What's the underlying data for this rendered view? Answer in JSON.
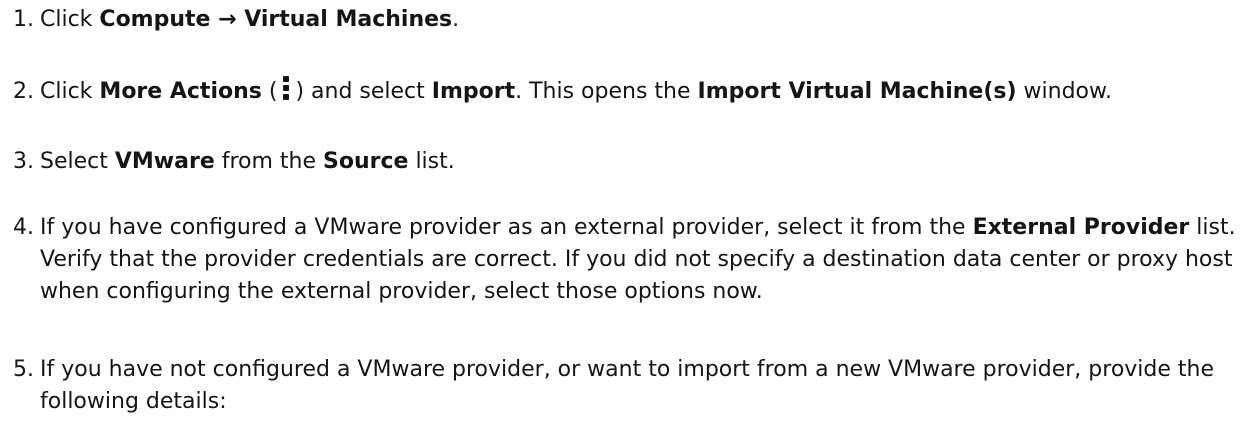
{
  "steps": [
    {
      "number": "1.",
      "t1": "Click ",
      "b1": "Compute → Virtual Machines",
      "t2": "."
    },
    {
      "number": "2.",
      "t1": "Click ",
      "b1": "More Actions",
      "t2": " (",
      "icon": "kebab-vertical-icon",
      "t3": ") and select ",
      "b2": "Import",
      "t4": ". This opens the ",
      "b3": "Import Virtual Machine(s)",
      "t5": " window."
    },
    {
      "number": "3.",
      "t1": "Select ",
      "b1": "VMware",
      "t2": " from the ",
      "b2": "Source",
      "t3": " list."
    },
    {
      "number": "4.",
      "t1": "If you have configured a VMware provider as an external provider, select it from the ",
      "b1": "External Provider",
      "t2": " list. Verify that the provider credentials are correct. If you did not specify a destination data center or proxy host when configuring the external provider, select those options now."
    },
    {
      "number": "5.",
      "t1": "If you have not configured a VMware provider, or want to import from a new VMware provider, provide the following details:"
    }
  ]
}
